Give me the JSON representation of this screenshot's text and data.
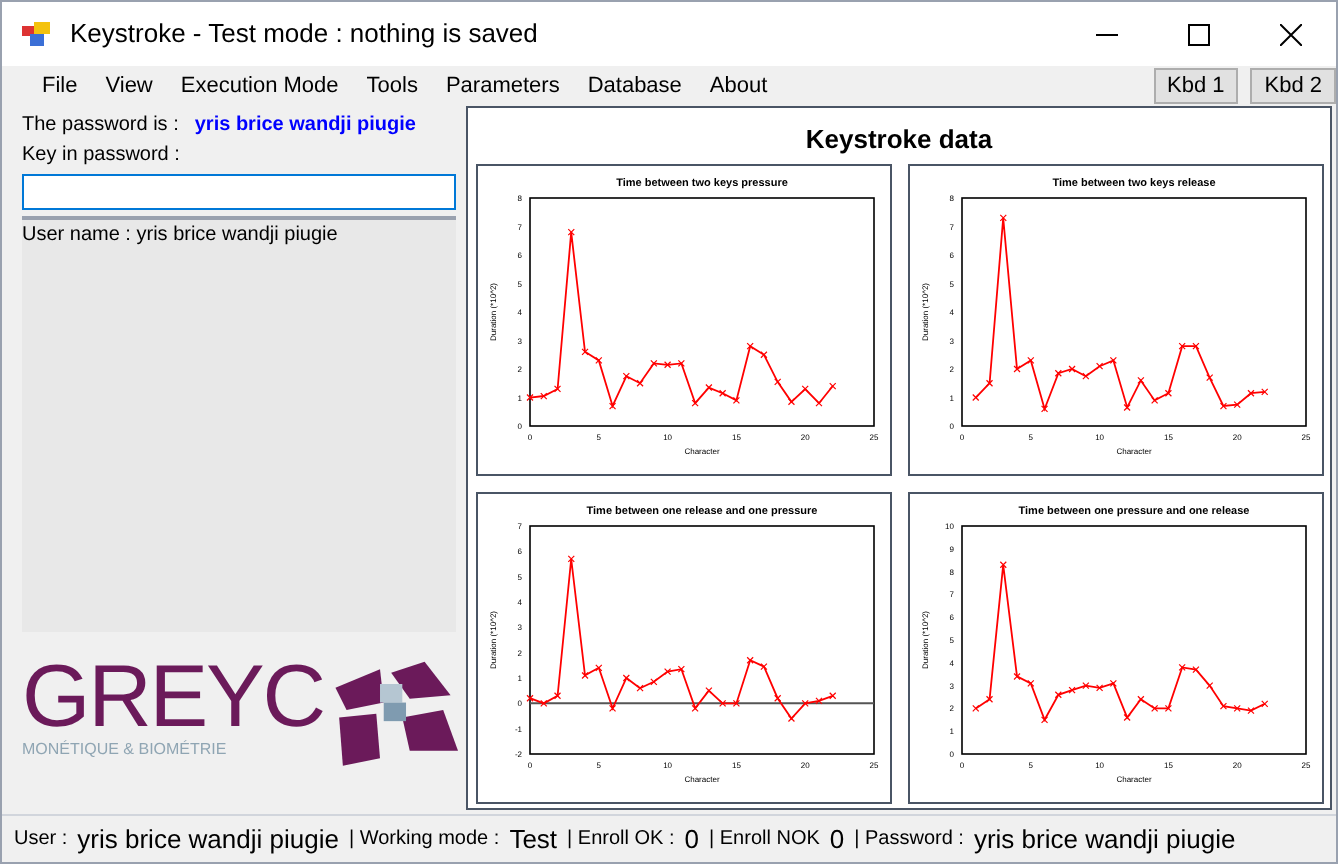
{
  "window": {
    "title": "Keystroke - Test mode : nothing is saved"
  },
  "menu": [
    "File",
    "View",
    "Execution Mode",
    "Tools",
    "Parameters",
    "Database",
    "About"
  ],
  "keyboard_buttons": [
    {
      "label": "Kbd 1"
    },
    {
      "label": "Kbd 2"
    }
  ],
  "left_panel": {
    "password_label": "The password is :",
    "password": "yris brice wandji piugie",
    "key_in_label": "Key in password :",
    "user_name": "User name : yris brice wandji piugie",
    "logo": {
      "name": "GREYC",
      "subtitle": "MONÉTIQUE & BIOMÉTRIE"
    }
  },
  "charts_panel": {
    "title": "Keystroke data",
    "charts": [
      {
        "chart_data": {
          "type": "line",
          "title": "Time between two keys pressure",
          "xlabel": "Character",
          "ylabel": "Duration (*10^2)",
          "x": [
            0,
            1,
            2,
            3,
            4,
            5,
            6,
            7,
            8,
            9,
            10,
            11,
            12,
            13,
            14,
            15,
            16,
            17,
            18,
            19,
            20,
            21,
            22
          ],
          "series": [
            {
              "color": "#ff0000",
              "marker": "x",
              "values": [
                1.0,
                1.05,
                1.3,
                6.8,
                2.6,
                2.3,
                0.7,
                1.75,
                1.5,
                2.2,
                2.15,
                2.2,
                0.8,
                1.35,
                1.15,
                0.9,
                2.8,
                2.5,
                1.55,
                0.85,
                1.3,
                0.8,
                1.4
              ]
            }
          ],
          "xlim": [
            0,
            25
          ],
          "ylim": [
            0,
            8
          ],
          "xticks": [
            0,
            5,
            10,
            15,
            20,
            25
          ],
          "yticks": [
            0,
            1,
            2,
            3,
            4,
            5,
            6,
            7,
            8
          ]
        }
      },
      {
        "chart_data": {
          "type": "line",
          "title": "Time between two keys release",
          "xlabel": "Character",
          "ylabel": "Duration (*10^2)",
          "x": [
            1,
            2,
            3,
            4,
            5,
            6,
            7,
            8,
            9,
            10,
            11,
            12,
            13,
            14,
            15,
            16,
            17,
            18,
            19,
            20,
            21,
            22
          ],
          "series": [
            {
              "color": "#ff0000",
              "marker": "x",
              "values": [
                1.0,
                1.5,
                7.3,
                2.0,
                2.3,
                0.6,
                1.85,
                2.0,
                1.75,
                2.1,
                2.3,
                0.65,
                1.6,
                0.9,
                1.15,
                2.8,
                2.8,
                1.7,
                0.7,
                0.75,
                1.15,
                1.2
              ]
            }
          ],
          "xlim": [
            0,
            25
          ],
          "ylim": [
            0,
            8
          ],
          "xticks": [
            0,
            5,
            10,
            15,
            20,
            25
          ],
          "yticks": [
            0,
            1,
            2,
            3,
            4,
            5,
            6,
            7,
            8
          ]
        }
      },
      {
        "chart_data": {
          "type": "line",
          "title": "Time between one release and one pressure",
          "xlabel": "Character",
          "ylabel": "Duration (*10^2)",
          "x": [
            0,
            1,
            2,
            3,
            4,
            5,
            6,
            7,
            8,
            9,
            10,
            11,
            12,
            13,
            14,
            15,
            16,
            17,
            18,
            19,
            20,
            21,
            22
          ],
          "series": [
            {
              "color": "#ff0000",
              "marker": "x",
              "values": [
                0.2,
                0.0,
                0.3,
                5.7,
                1.1,
                1.4,
                -0.2,
                1.0,
                0.6,
                0.85,
                1.25,
                1.35,
                -0.2,
                0.5,
                0.0,
                0.0,
                1.7,
                1.45,
                0.2,
                -0.6,
                0.0,
                0.1,
                0.3
              ]
            }
          ],
          "xlim": [
            0,
            25
          ],
          "ylim": [
            -2,
            7
          ],
          "xticks": [
            0,
            5,
            10,
            15,
            20,
            25
          ],
          "yticks": [
            -2,
            -1,
            0,
            1,
            2,
            3,
            4,
            5,
            6,
            7
          ]
        }
      },
      {
        "chart_data": {
          "type": "line",
          "title": "Time between one pressure and one release",
          "xlabel": "Character",
          "ylabel": "Duration (*10^2)",
          "x": [
            1,
            2,
            3,
            4,
            5,
            6,
            7,
            8,
            9,
            10,
            11,
            12,
            13,
            14,
            15,
            16,
            17,
            18,
            19,
            20,
            21,
            22
          ],
          "series": [
            {
              "color": "#ff0000",
              "marker": "x",
              "values": [
                2.0,
                2.4,
                8.3,
                3.4,
                3.1,
                1.5,
                2.6,
                2.8,
                3.0,
                2.9,
                3.1,
                1.6,
                2.4,
                2.0,
                2.0,
                3.8,
                3.7,
                3.0,
                2.1,
                2.0,
                1.9,
                2.2
              ]
            }
          ],
          "xlim": [
            0,
            25
          ],
          "ylim": [
            0,
            10
          ],
          "xticks": [
            0,
            5,
            10,
            15,
            20,
            25
          ],
          "yticks": [
            0,
            1,
            2,
            3,
            4,
            5,
            6,
            7,
            8,
            9,
            10
          ]
        }
      }
    ]
  },
  "status_bar": [
    {
      "label": "User :",
      "value": "yris brice wandji piugie"
    },
    {
      "label": "| Working mode :",
      "value": "Test"
    },
    {
      "label": "| Enroll OK :",
      "value": "0"
    },
    {
      "label": "| Enroll NOK",
      "value": "0"
    },
    {
      "label": "| Password :",
      "value": "yris brice wandji piugie"
    }
  ]
}
